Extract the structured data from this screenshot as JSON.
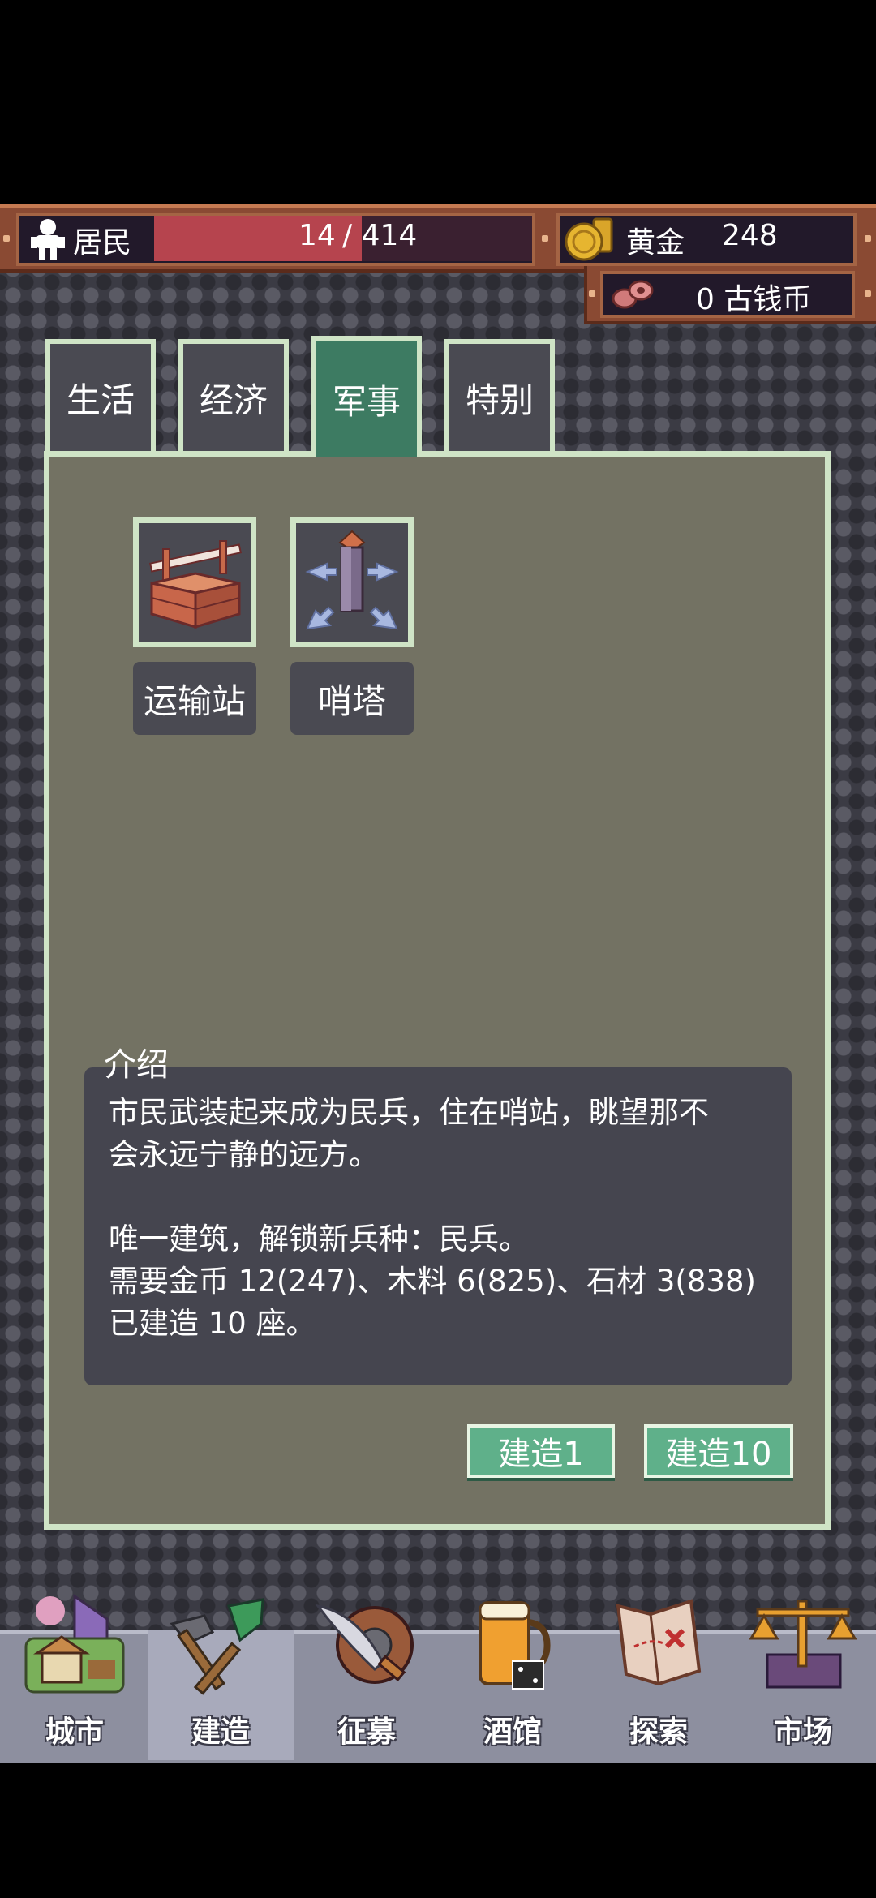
{
  "resources": {
    "residents_label": "居民",
    "residents_current": "14",
    "residents_sep_max": "/ 414",
    "residents_fill": 0.55,
    "gold_label": "黄金",
    "gold_value": "248",
    "ancient_coin_text": "0 古钱币"
  },
  "tabs": [
    {
      "label": "生活",
      "active": false
    },
    {
      "label": "经济",
      "active": false
    },
    {
      "label": "军事",
      "active": true
    },
    {
      "label": "特别",
      "active": false
    }
  ],
  "buildings": [
    {
      "name": "运输站",
      "icon": "transport-station-icon"
    },
    {
      "name": "哨塔",
      "icon": "watchtower-icon"
    }
  ],
  "intro": {
    "title": "介绍",
    "lines": [
      "市民武装起来成为民兵，住在哨站，眺望那不",
      "会永远宁静的远方。",
      "",
      "唯一建筑，解锁新兵种：民兵。",
      "需要金币 12(247)、木料 6(825)、石材 3(838)",
      "已建造 10 座。"
    ]
  },
  "actions": {
    "build1": "建造1",
    "build10": "建造10"
  },
  "nav": [
    {
      "label": "城市",
      "icon": "city-icon",
      "active": false
    },
    {
      "label": "建造",
      "icon": "build-shovel-icon",
      "active": true
    },
    {
      "label": "征募",
      "icon": "recruit-sword-shield-icon",
      "active": false
    },
    {
      "label": "酒馆",
      "icon": "tavern-beer-icon",
      "active": false
    },
    {
      "label": "探索",
      "icon": "explore-map-icon",
      "active": false
    },
    {
      "label": "市场",
      "icon": "market-scales-icon",
      "active": false
    }
  ],
  "colors": {
    "accent_green": "#3d7b62",
    "button_green": "#5fb08a",
    "panel_border": "#cfe4c6",
    "resident_bar": "#b6444e"
  }
}
